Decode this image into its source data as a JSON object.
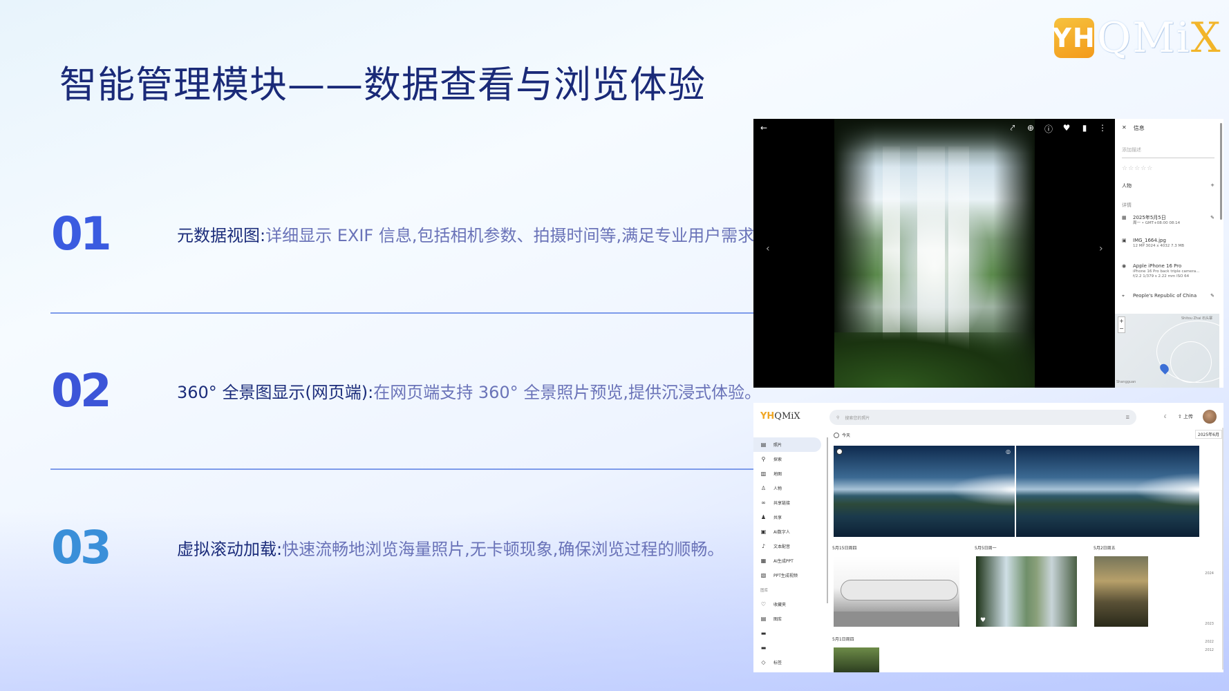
{
  "logo": {
    "mark": "YH",
    "qmi": "QMi",
    "x": "X"
  },
  "title": "智能管理模块——数据查看与浏览体验",
  "items": [
    {
      "num": "01",
      "key": "元数据视图:",
      "value": "详细显示 EXIF 信息,包括相机参数、拍摄时间等,满足专业用户需求。"
    },
    {
      "num": "02",
      "key": "360° 全景图显示(网页端):",
      "value": "在网页端支持 360° 全景照片预览,提供沉浸式体验。"
    },
    {
      "num": "03",
      "key": "虚拟滚动加载:",
      "value": "快速流畅地浏览海量照片,无卡顿现象,确保浏览过程的顺畅。"
    }
  ],
  "viewer": {
    "icons": [
      "back-icon",
      "share-icon",
      "zoom-icon",
      "info-icon",
      "heart-icon",
      "delete-icon",
      "more-icon"
    ],
    "info_title": "信息",
    "description_placeholder": "添加描述",
    "people_label": "人物",
    "details_label": "详情",
    "date": "2025年5月5日",
    "date_sub": "周一 • GMT+08:00 08:14",
    "filename": "IMG_1664.jpg",
    "file_sub": "12 MP  3024 x 4032  7.3 MB",
    "camera": "Apple iPhone 16 Pro",
    "camera_sub1": "iPhone 16 Pro back triple camera...",
    "camera_sub2": "f/2.2  1/379 s  2.22 mm  ISO 64",
    "location": "People's Republic of China",
    "map_label_1": "Shitou Zhai\n石头寨",
    "map_label_2": "Shangguan"
  },
  "gallery": {
    "logo_mark": "YH",
    "logo_text": "QMiX",
    "search_placeholder": "搜索您的照片",
    "upload_label": "上传",
    "date_tag": "2025年6月",
    "sidebar": [
      {
        "icon": "photos-icon",
        "label": "照片",
        "active": true
      },
      {
        "icon": "search-icon",
        "label": "探索",
        "active": false
      },
      {
        "icon": "map-icon",
        "label": "地图",
        "active": false
      },
      {
        "icon": "person-icon",
        "label": "人物",
        "active": false
      },
      {
        "icon": "link-icon",
        "label": "共享链接",
        "active": false
      },
      {
        "icon": "share-icon",
        "label": "共享",
        "active": false
      },
      {
        "icon": "ai-person-icon",
        "label": "AI数字人",
        "active": false
      },
      {
        "icon": "mic-icon",
        "label": "文本配音",
        "active": false
      },
      {
        "icon": "ppt-icon",
        "label": "AI生成PPT",
        "active": false
      },
      {
        "icon": "video-icon",
        "label": "PPT生成视频",
        "active": false
      }
    ],
    "library_label": "图库",
    "library_items": [
      {
        "icon": "heart-icon",
        "label": "收藏夹"
      },
      {
        "icon": "album-icon",
        "label": "图库"
      }
    ],
    "tags_label": "标签",
    "today": "今天",
    "groups": [
      "5月15日周四",
      "5月5日周一",
      "5月2日周五",
      "5月1日周四"
    ],
    "timeline": [
      "2024",
      "2023",
      "2022",
      "2012"
    ]
  }
}
